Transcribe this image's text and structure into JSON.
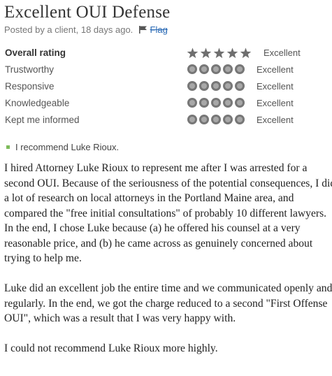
{
  "review": {
    "title": "Excellent OUI Defense",
    "meta": "Posted by a client, 18 days ago.",
    "flag_label": "Flag",
    "overall": {
      "label": "Overall rating",
      "stars": 5,
      "value": "Excellent"
    },
    "criteria": [
      {
        "label": "Trustworthy",
        "score": 5,
        "value": "Excellent"
      },
      {
        "label": "Responsive",
        "score": 5,
        "value": "Excellent"
      },
      {
        "label": "Knowledgeable",
        "score": 5,
        "value": "Excellent"
      },
      {
        "label": "Kept me informed",
        "score": 5,
        "value": "Excellent"
      }
    ],
    "recommend": "I recommend Luke Rioux.",
    "paragraphs": [
      "I hired Attorney Luke Rioux to represent me after I was arrested for a second OUI. Because of the seriousness of the potential consequences, I did a lot of research on local attorneys in the Portland Maine area, and compared the \"free initial consultations\" of probably 10 different lawyers. In the end, I chose Luke because (a) he offered his counsel at a very reasonable price, and (b) he came across as genuinely concerned about trying to help me.",
      "Luke did an excellent job the entire time and we communicated openly and regularly. In the end, we got the charge reduced to a second \"First Offense OUI\", which was a result that I was very happy with.",
      "I could not recommend Luke Rioux more highly."
    ]
  },
  "colors": {
    "star": "#6f6f6f",
    "dot_outer": "#777777",
    "dot_inner": "#a8a8a8",
    "link": "#2a6ab5",
    "bullet": "#7dbb5a"
  }
}
